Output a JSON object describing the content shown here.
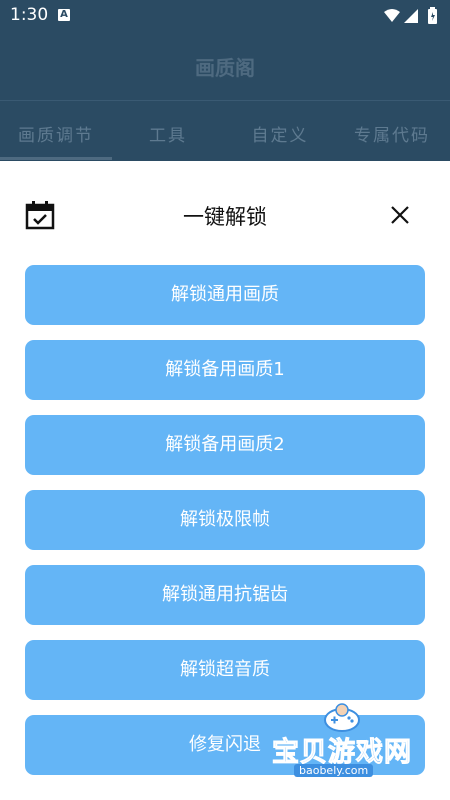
{
  "status_bar": {
    "time": "1:30",
    "notification_badge": "A"
  },
  "app": {
    "title": "画质阁",
    "tabs": [
      {
        "label": "画质调节"
      },
      {
        "label": "工具"
      },
      {
        "label": "自定义"
      },
      {
        "label": "专属代码"
      }
    ]
  },
  "sheet": {
    "title": "一键解锁",
    "buttons": [
      {
        "label": "解锁通用画质"
      },
      {
        "label": "解锁备用画质1"
      },
      {
        "label": "解锁备用画质2"
      },
      {
        "label": "解锁极限帧"
      },
      {
        "label": "解锁通用抗锯齿"
      },
      {
        "label": "解锁超音质"
      },
      {
        "label": "修复闪退"
      }
    ]
  },
  "watermark": {
    "name": "宝贝游戏网",
    "url": "baobely.com"
  },
  "colors": {
    "app_bar": "#2b4b63",
    "button": "#64b5f6",
    "watermark": "#3d8fe0"
  }
}
